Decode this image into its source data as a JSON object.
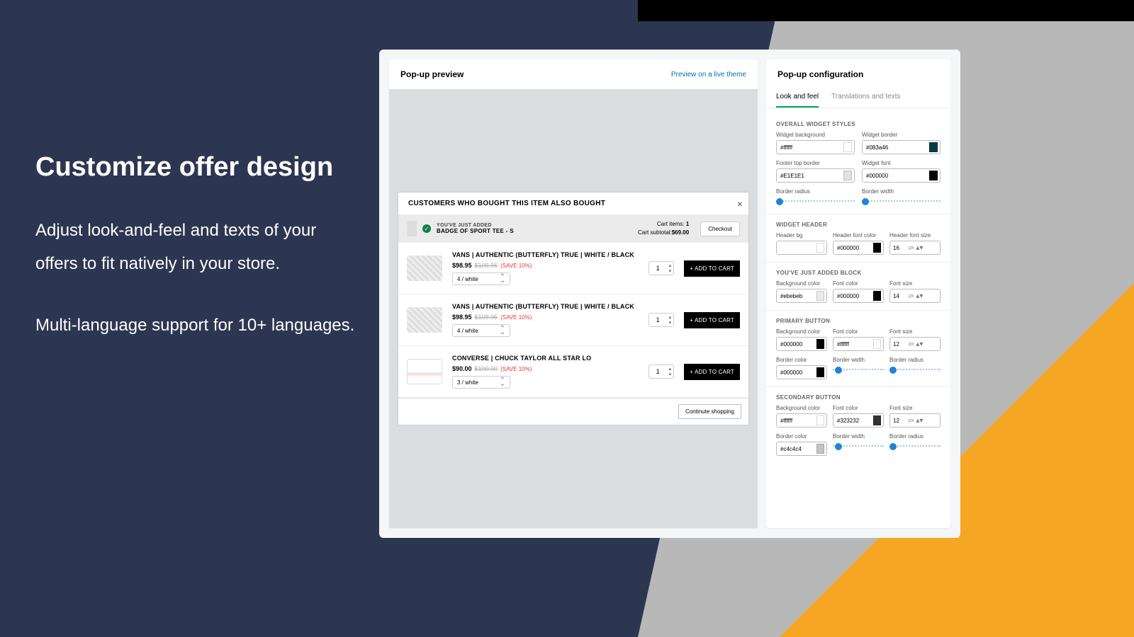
{
  "marketing": {
    "title": "Customize offer design",
    "p1": "Adjust look-and-feel and texts of your offers to fit natively in your store.",
    "p2": "Multi-language support for 10+ languages."
  },
  "preview": {
    "title": "Pop-up preview",
    "link": "Preview on a live theme"
  },
  "popup": {
    "title": "CUSTOMERS WHO BOUGHT THIS ITEM ALSO BOUGHT",
    "added_label": "YOU'VE JUST ADDED",
    "added_name": "BADGE OF SPORT TEE - S",
    "cart_items_label": "Cart items:",
    "cart_items": "1",
    "subtotal_label": "Cart subtotal:",
    "subtotal": "$69.00",
    "checkout": "Checkout",
    "continue": "Continute shopping",
    "atc": "+ ADD TO CART",
    "products": [
      {
        "name": "VANS | AUTHENTIC (BUTTERFLY) TRUE | WHITE / BLACK",
        "price": "$98.95",
        "old": "$109.95",
        "save": "(SAVE 10%)",
        "variant": "4 / white",
        "qty": "1",
        "shoe": false
      },
      {
        "name": "VANS | AUTHENTIC (BUTTERFLY) TRUE | WHITE / BLACK",
        "price": "$98.95",
        "old": "$109.95",
        "save": "(SAVE 10%)",
        "variant": "4 / white",
        "qty": "1",
        "shoe": false
      },
      {
        "name": "CONVERSE | CHUCK TAYLOR ALL STAR LO",
        "price": "$90.00",
        "old": "$100.00",
        "save": "(SAVE 10%)",
        "variant": "3 / white",
        "qty": "1",
        "shoe": true
      }
    ]
  },
  "config": {
    "title": "Pop-up configuration",
    "tabs": {
      "look": "Look and feel",
      "trans": "Translations and texts"
    },
    "labels": {
      "overall": "OVERALL WIDGET STYLES",
      "wbg": "Widget background",
      "wbrd": "Widget border",
      "ftb": "Footer top border",
      "wfont": "Widget font",
      "bradius": "Border radius",
      "bwidth": "Border width",
      "whdr": "WIDGET HEADER",
      "hbg": "Header bg",
      "hfc": "Header font color",
      "hfs": "Header font size",
      "added": "YOU'VE JUST ADDED BLOCK",
      "bgc": "Background color",
      "fc": "Font color",
      "fs": "Font size",
      "pbtn": "PRIMARY BUTTON",
      "sbtn": "SECONDARY BUTTON",
      "bc": "Border color"
    },
    "values": {
      "wbg": "#ffffff",
      "wbrd": "#083a46",
      "ftb": "#E1E1E1",
      "wfont": "#000000",
      "hbg": "",
      "hfc": "#000000",
      "hfs": "16",
      "abg": "#ebebeb",
      "afc": "#000000",
      "afs": "14",
      "pbg": "#000000",
      "pfc": "#ffffff",
      "pfs": "12",
      "pbc": "#000000",
      "sbg": "#ffffff",
      "sfc": "#323232",
      "sfs": "12",
      "sbc": "#c4c4c4",
      "px": "px"
    },
    "slider_pos": {
      "bradius": "0%",
      "bwidth": "0%",
      "pbw": "4%",
      "pbr": "0%",
      "sbw": "4%",
      "sbr": "0%"
    }
  }
}
